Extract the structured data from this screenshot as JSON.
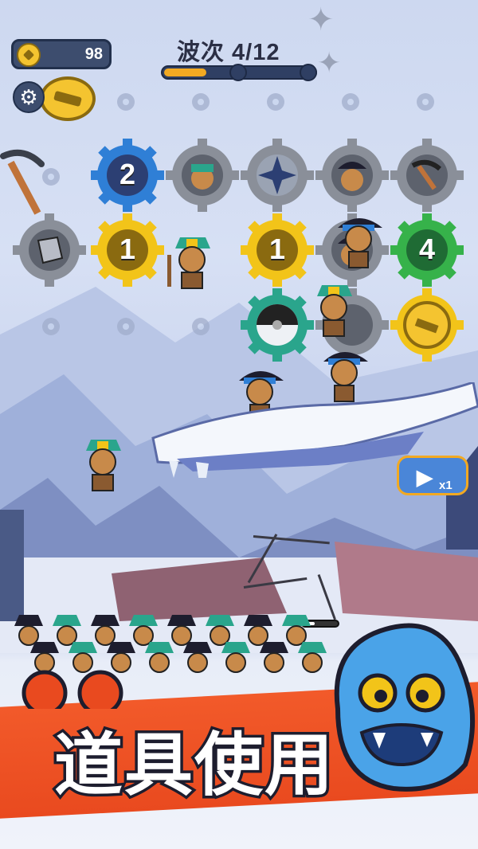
{
  "hud": {
    "coins": "98",
    "wave_label": "波次 4/12",
    "wave_progress": 0.28
  },
  "board": {
    "row1": [
      {
        "type": "number",
        "value": "2",
        "color": "#2f7fd6"
      },
      {
        "type": "hero",
        "color": "#8a8f99"
      },
      {
        "type": "shuriken",
        "color": "#8a8f99"
      },
      {
        "type": "hero",
        "color": "#8a8f99"
      },
      {
        "type": "pickaxe",
        "color": "#8a8f99"
      }
    ],
    "row2": [
      {
        "type": "stone",
        "color": "#8a8f99"
      },
      {
        "type": "number",
        "value": "1",
        "color": "#f2c419"
      },
      {
        "type": "empty"
      },
      {
        "type": "number",
        "value": "1",
        "color": "#f2c419"
      },
      {
        "type": "hero",
        "color": "#8a8f99"
      },
      {
        "type": "number",
        "value": "4",
        "color": "#36b24a"
      }
    ],
    "row3": [
      {
        "type": "saw",
        "color": "#2aa58c"
      },
      {
        "type": "hero",
        "color": "#8a8f99"
      },
      {
        "type": "coin",
        "color": "#f2c419"
      }
    ]
  },
  "speed": {
    "label": "x1"
  },
  "banner": {
    "text": "道具使用"
  },
  "colors": {
    "accent": "#f2a922",
    "banner": "#f25a2a",
    "monster": "#4aa3e8"
  }
}
